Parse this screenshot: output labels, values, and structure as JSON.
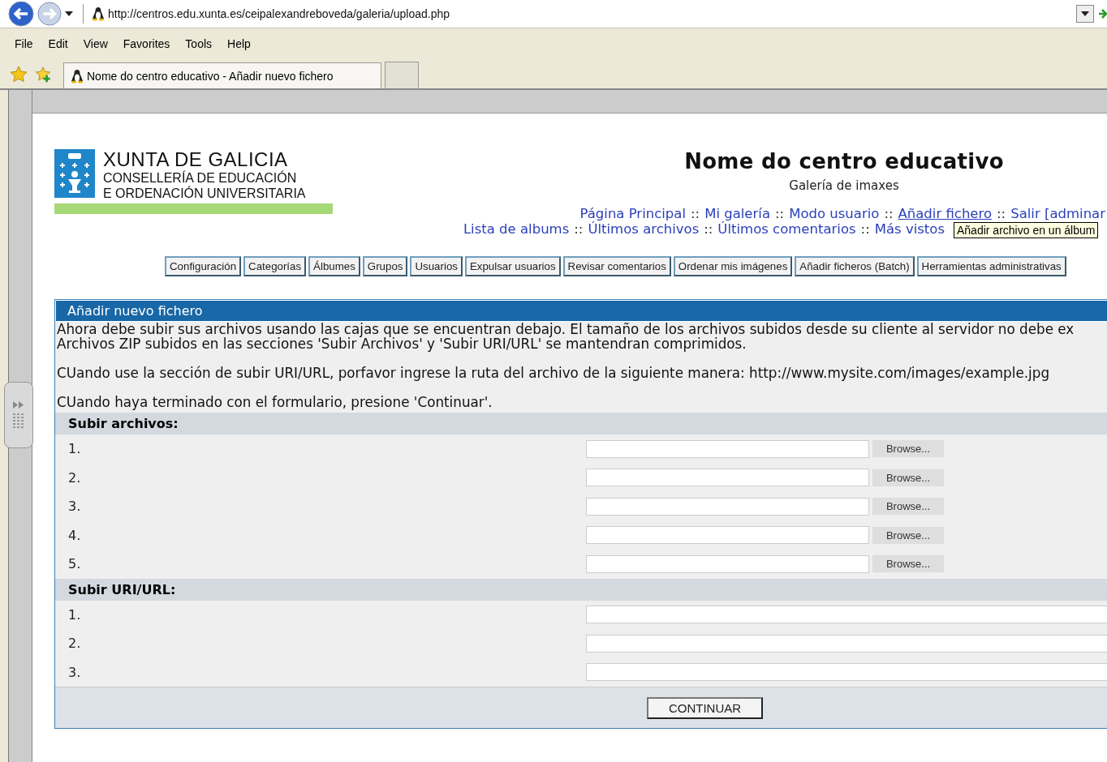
{
  "browser": {
    "url": "http://centros.edu.xunta.es/ceipalexandreboveda/galeria/upload.php",
    "menu": [
      "File",
      "Edit",
      "View",
      "Favorites",
      "Tools",
      "Help"
    ],
    "tab_title": "Nome do centro educativo - Añadir nuevo fichero"
  },
  "header": {
    "logo_title": "XUNTA DE GALICIA",
    "logo_lines": [
      "CONSELLERÍA DE EDUCACIÓN",
      "E ORDENACIÓN UNIVERSITARIA"
    ],
    "site_title": "Nome do centro educativo",
    "subtitle": "Galería de imaxes"
  },
  "nav_rows": [
    [
      {
        "kind": "link",
        "label": "Página Principal",
        "hovered": false
      },
      {
        "kind": "sep",
        "label": "::"
      },
      {
        "kind": "link",
        "label": "Mi galería",
        "hovered": false
      },
      {
        "kind": "sep",
        "label": "::"
      },
      {
        "kind": "link",
        "label": "Modo usuario",
        "hovered": false
      },
      {
        "kind": "sep",
        "label": "::"
      },
      {
        "kind": "link",
        "label": "Añadir fichero",
        "hovered": true
      },
      {
        "kind": "sep",
        "label": "::"
      },
      {
        "kind": "link",
        "label": "Salir [adminar",
        "hovered": false
      }
    ],
    [
      {
        "kind": "link",
        "label": "Lista de albums",
        "hovered": false
      },
      {
        "kind": "sep",
        "label": "::"
      },
      {
        "kind": "link",
        "label": "Últimos archivos",
        "hovered": false
      },
      {
        "kind": "sep",
        "label": "::"
      },
      {
        "kind": "link",
        "label": "Últimos comentarios",
        "hovered": false
      },
      {
        "kind": "sep",
        "label": "::"
      },
      {
        "kind": "link",
        "label": "Más vistos",
        "hovered": false
      }
    ]
  ],
  "tooltip": "Añadir archivo en un álbum",
  "admin_buttons": [
    "Configuración",
    "Categorías",
    "Álbumes",
    "Grupos",
    "Usuarios",
    "Expulsar usuarios",
    "Revisar comentarios",
    "Ordenar mis imágenes",
    "Añadir ficheros (Batch)",
    "Herramientas administrativas"
  ],
  "panel": {
    "title": "Añadir nuevo fichero",
    "paragraphs": [
      [
        "Ahora debe subir sus archivos usando las cajas que se encuentran debajo. El tamaño de los archivos subidos desde su cliente al servidor no debe ex",
        "Archivos ZIP subidos en las secciones 'Subir Archivos' y 'Subir URI/URL' se mantendran comprimidos."
      ],
      [
        "CUando use la sección de subir URI/URL, porfavor ingrese la ruta del archivo de la siguiente manera: http://www.mysite.com/images/example.jpg"
      ],
      [
        "CUando haya terminado con el formulario, presione 'Continuar'."
      ]
    ],
    "sections": [
      {
        "title": "Subir archivos:",
        "kind": "file",
        "rows": [
          {
            "number": "1.",
            "button": "Browse..."
          },
          {
            "number": "2.",
            "button": "Browse..."
          },
          {
            "number": "3.",
            "button": "Browse..."
          },
          {
            "number": "4.",
            "button": "Browse..."
          },
          {
            "number": "5.",
            "button": "Browse..."
          }
        ]
      },
      {
        "title": "Subir URI/URL:",
        "kind": "url",
        "rows": [
          {
            "number": "1."
          },
          {
            "number": "2."
          },
          {
            "number": "3."
          }
        ]
      }
    ],
    "submit": "CONTINUAR"
  }
}
